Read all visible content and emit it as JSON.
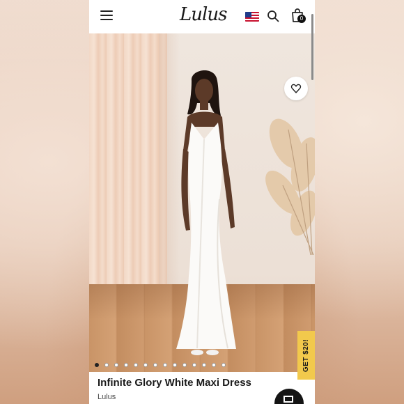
{
  "header": {
    "logo_text": "Lulus",
    "cart_count": "0",
    "menu_icon": "hamburger-menu-icon",
    "flag_icon": "us-flag-icon",
    "search_icon": "search-icon",
    "cart_icon": "shopping-bag-icon"
  },
  "gallery": {
    "image_count": 14,
    "active_index": 0,
    "wishlist_icon": "heart-icon"
  },
  "promo": {
    "label": "GET $20!",
    "color": "#f2c94c"
  },
  "product": {
    "title": "Infinite Glory White Maxi Dress",
    "brand": "Lulus"
  },
  "chat": {
    "icon": "chat-icon"
  }
}
